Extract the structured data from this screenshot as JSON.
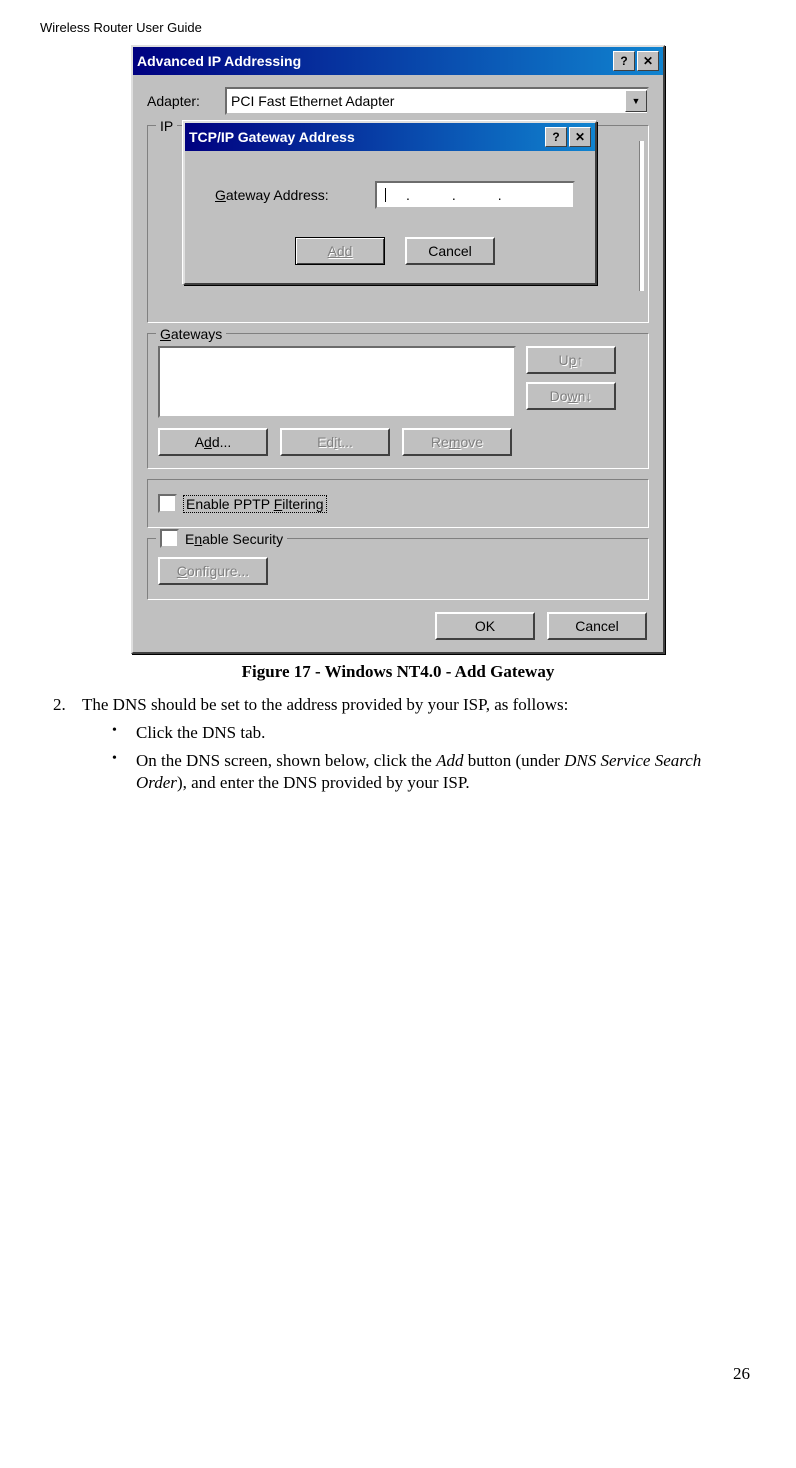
{
  "header": "Wireless Router User Guide",
  "dialog": {
    "title": "Advanced IP Addressing",
    "adapter_label": "Adapter:",
    "adapter_value": "PCI Fast Ethernet Adapter",
    "ip_label": "IP",
    "inner": {
      "title": "TCP/IP Gateway Address",
      "gateway_label": "Gateway Address:",
      "add_btn": "Add",
      "cancel_btn": "Cancel"
    },
    "gateways": {
      "label": "Gateways",
      "up_btn": "Up↑",
      "down_btn": "Down↓",
      "add_btn": "Add...",
      "edit_btn": "Edit...",
      "remove_btn": "Remove"
    },
    "pptp_label": "Enable PPTP Filtering",
    "security": {
      "label": "Enable Security",
      "configure_btn": "Configure..."
    },
    "ok_btn": "OK",
    "cancel_btn": "Cancel"
  },
  "caption": "Figure 17 - Windows NT4.0 - Add Gateway",
  "step_text": "The DNS should be set to the address provided by your ISP, as follows:",
  "bullet1": "Click the DNS tab.",
  "bullet2_pre": "On the DNS screen, shown below, click the ",
  "bullet2_add": "Add",
  "bullet2_mid": " button (under ",
  "bullet2_dns": "DNS Service Search Order",
  "bullet2_end": "), and enter the DNS provided by your ISP.",
  "page_number": "26"
}
